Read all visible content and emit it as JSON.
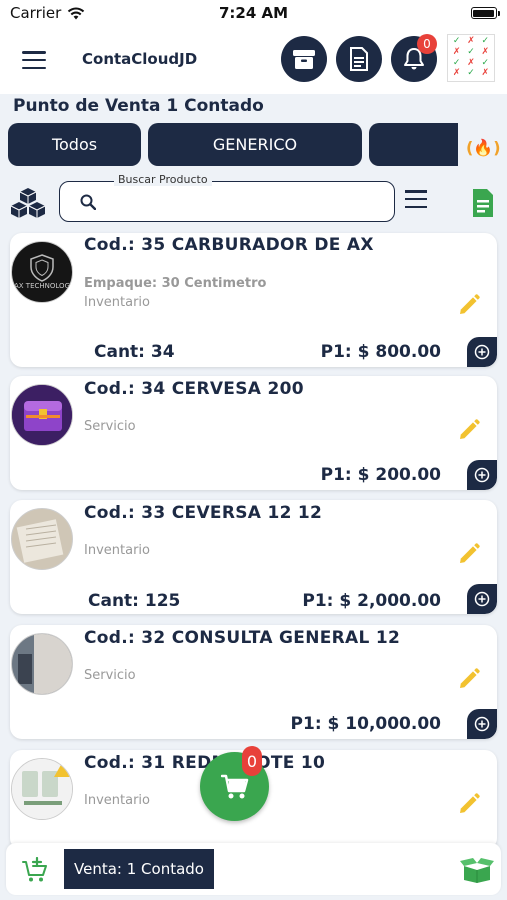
{
  "status_bar": {
    "carrier": "Carrier",
    "time": "7:24 AM"
  },
  "app_bar": {
    "title": "ContaCloudJD",
    "notification_count": "0"
  },
  "page": {
    "title": "Punto de Venta 1 Contado"
  },
  "tabs": [
    {
      "label": "Todos"
    },
    {
      "label": "GENERICO"
    },
    {
      "label": ""
    }
  ],
  "search": {
    "label": "Buscar Producto",
    "value": "",
    "placeholder": ""
  },
  "products": [
    {
      "code": "Cod.: 35 CARBURADOR DE AX",
      "empaque": "Empaque: 30 Centimetro",
      "kind": "Inventario",
      "cant": "Cant: 34",
      "price": "P1: $ 800.00",
      "thumb_text": "AX TECHNOLOG"
    },
    {
      "code": "Cod.: 34 CERVESA 200",
      "empaque": "",
      "kind": "Servicio",
      "cant": "",
      "price": "P1: $ 200.00",
      "thumb_text": ""
    },
    {
      "code": "Cod.: 33 CEVERSA 12 12",
      "empaque": "",
      "kind": "Inventario",
      "cant": "Cant: 125",
      "price": "P1: $ 2,000.00",
      "thumb_text": ""
    },
    {
      "code": "Cod.: 32 CONSULTA GENERAL 12",
      "empaque": "",
      "kind": "Servicio",
      "cant": "",
      "price": "P1: $ 10,000.00",
      "thumb_text": ""
    },
    {
      "code": "Cod.: 31 REDMI NOTE 10",
      "empaque": "",
      "kind": "Inventario",
      "cant": "",
      "price": "",
      "thumb_text": ""
    }
  ],
  "cart": {
    "count": "0"
  },
  "bottom_bar": {
    "venta_label": "Venta: 1 Contado"
  },
  "colors": {
    "navy": "#1d2a44",
    "green": "#3aa64f",
    "red": "#e8413a",
    "yellow": "#f2c230"
  }
}
